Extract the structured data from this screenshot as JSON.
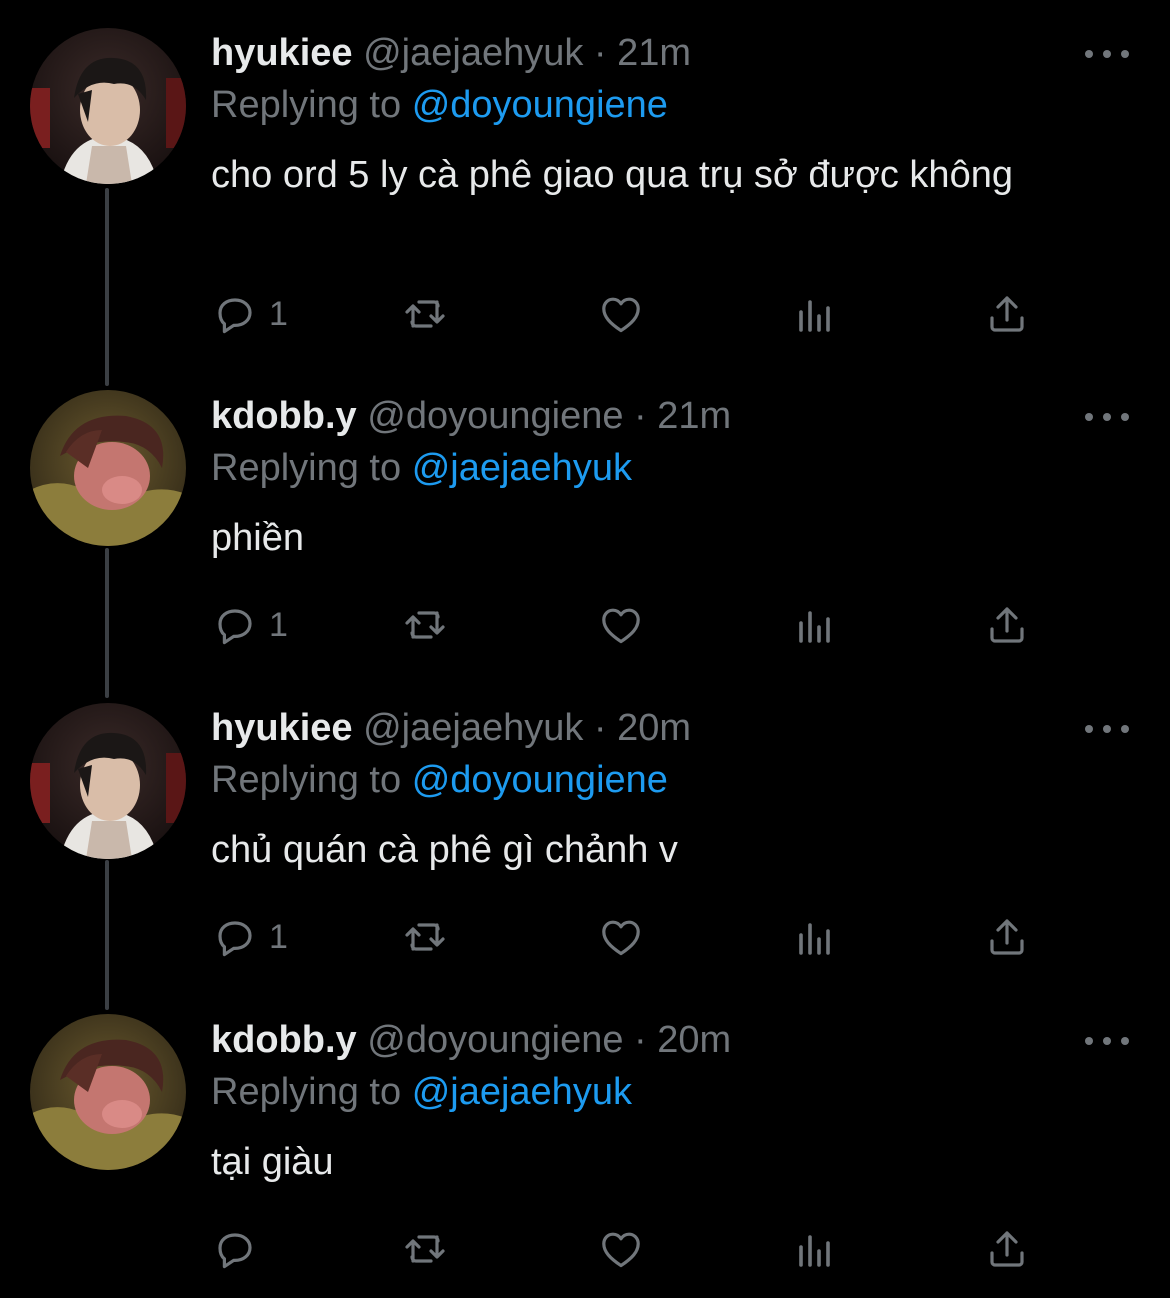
{
  "tweets": [
    {
      "display_name": "hyukiee",
      "handle": "@jaejaehyuk",
      "separator": "·",
      "time": "21m",
      "replying_label": "Replying to",
      "replying_to": "@doyoungiene",
      "text": "cho ord 5 ly cà phê giao qua trụ sở được không",
      "reply_count": "1",
      "avatar": "avatar-hyukiee"
    },
    {
      "display_name": "kdobb.y",
      "handle": "@doyoungiene",
      "separator": "·",
      "time": "21m",
      "replying_label": "Replying to",
      "replying_to": "@jaejaehyuk",
      "text": "phiền",
      "reply_count": "1",
      "avatar": "avatar-kdobb"
    },
    {
      "display_name": "hyukiee",
      "handle": "@jaejaehyuk",
      "separator": "·",
      "time": "20m",
      "replying_label": "Replying to",
      "replying_to": "@doyoungiene",
      "text": "chủ quán cà phê gì chảnh v",
      "reply_count": "1",
      "avatar": "avatar-hyukiee"
    },
    {
      "display_name": "kdobb.y",
      "handle": "@doyoungiene",
      "separator": "·",
      "time": "20m",
      "replying_label": "Replying to",
      "replying_to": "@jaejaehyuk",
      "text": "tại giàu",
      "reply_count": "",
      "avatar": "avatar-kdobb"
    }
  ],
  "icons": {
    "reply": "reply-icon",
    "retweet": "retweet-icon",
    "like": "heart-icon",
    "stats": "analytics-icon",
    "share": "share-icon",
    "more": "more-icon"
  },
  "colors": {
    "background": "#000000",
    "primary_text": "#e7e9ea",
    "secondary_text": "#71767b",
    "link": "#1d9bf0",
    "thread_line": "#3b3f44"
  }
}
